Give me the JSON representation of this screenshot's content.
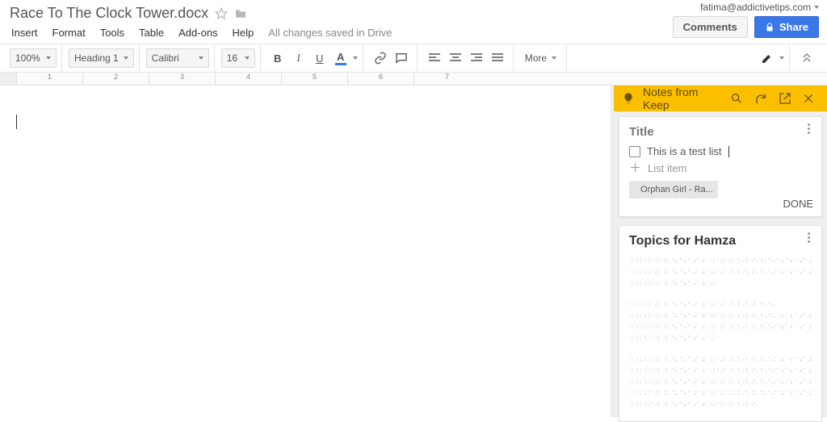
{
  "doc": {
    "title": "Race To The Clock Tower.docx",
    "menu": [
      "Insert",
      "Format",
      "Tools",
      "Table",
      "Add-ons",
      "Help"
    ],
    "save_status": "All changes saved in Drive"
  },
  "account": {
    "email": "fatima@addictivetips.com",
    "comments_label": "Comments",
    "share_label": "Share"
  },
  "toolbar": {
    "zoom": "100%",
    "style": "Heading 1",
    "font": "Calibri",
    "size": "16",
    "more_label": "More"
  },
  "ruler": {
    "labels": [
      "1",
      "2",
      "3",
      "4",
      "5",
      "6",
      "7"
    ]
  },
  "keep": {
    "panel_title": "Notes from Keep",
    "note1": {
      "title": "Title",
      "checklist_item": "This is a test list",
      "add_item": "List item",
      "chip_label": "Orphan Girl - Ra...",
      "done": "DONE"
    },
    "note2": {
      "title": "Topics for Hamza"
    }
  }
}
